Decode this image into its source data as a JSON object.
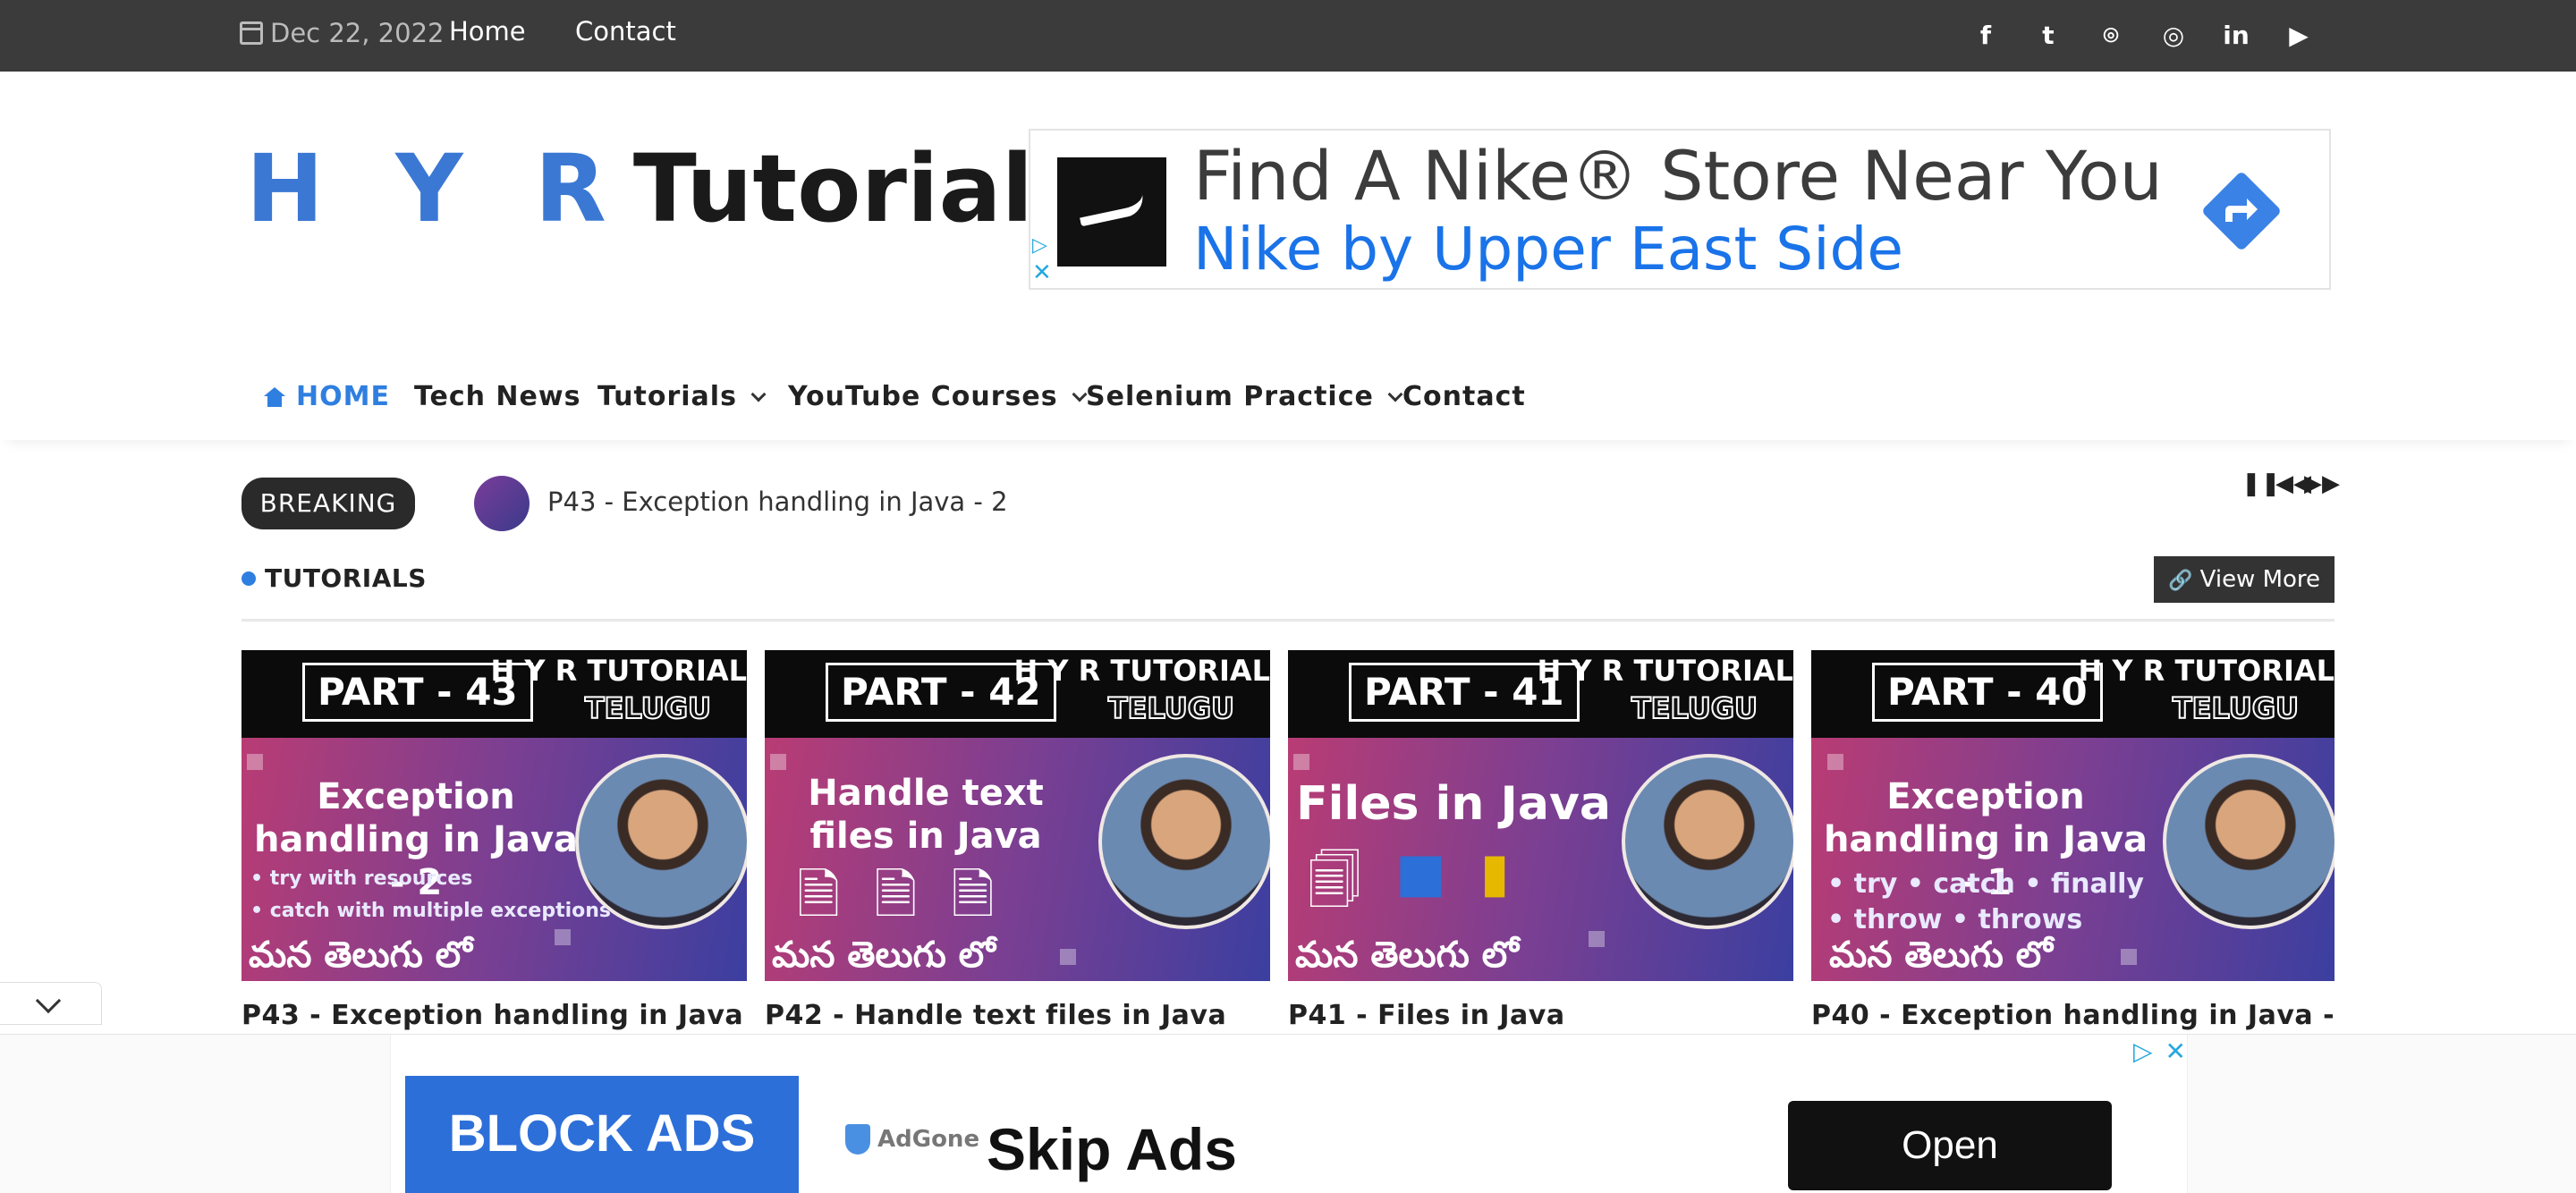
{
  "topbar": {
    "date": "Dec 22, 2022",
    "links": [
      "Home",
      "Contact"
    ],
    "social_icons": [
      "facebook-icon",
      "twitter-icon",
      "github-icon",
      "instagram-icon",
      "linkedin-icon",
      "youtube-icon"
    ],
    "social_glyphs": [
      "f",
      "t",
      "⌾",
      "◎",
      "in",
      "▶"
    ]
  },
  "logo": {
    "hyr": "H Y R",
    "tutorials": "Tutorials"
  },
  "top_ad": {
    "title": "Find A Nike® Store Near You",
    "subtitle": "Nike by Upper East Side",
    "info_icon": "▷",
    "close_icon": "✕"
  },
  "nav": {
    "items": [
      {
        "label": "HOME",
        "active": true
      },
      {
        "label": "Tech News"
      },
      {
        "label": "Tutorials",
        "dropdown": true
      },
      {
        "label": "YouTube Courses",
        "dropdown": true
      },
      {
        "label": "Selenium Practice",
        "dropdown": true
      },
      {
        "label": "Contact"
      }
    ]
  },
  "breaking": {
    "badge": "BREAKING",
    "text": "P43 - Exception handling in Java - 2",
    "controls": [
      "❚❚",
      "◀◀",
      "▶▶"
    ]
  },
  "section": {
    "title": "TUTORIALS",
    "view_more": "View More",
    "link_icon": "🔗"
  },
  "cards": [
    {
      "part": "PART - 43",
      "brand": "H Y R TUTORIAL",
      "telugu_tag": "TELUGU",
      "headline": "Exception handling in Java - 2",
      "bullets": [
        "• try with resources",
        "• catch with multiple exceptions"
      ],
      "footer": "మన తెలుగు లో",
      "title": "P43 - Exception handling in Java"
    },
    {
      "part": "PART - 42",
      "brand": "H Y R TUTORIAL",
      "telugu_tag": "TELUGU",
      "headline": "Handle text files in Java",
      "bullets": [],
      "footer": "మన తెలుగు లో",
      "title": "P42 - Handle text files in Java"
    },
    {
      "part": "PART - 41",
      "brand": "H Y R TUTORIAL",
      "telugu_tag": "TELUGU",
      "headline": "Files in Java",
      "bullets": [],
      "footer": "మన తెలుగు లో",
      "title": "P41 - Files in Java"
    },
    {
      "part": "PART - 40",
      "brand": "H Y R TUTORIAL",
      "telugu_tag": "TELUGU",
      "headline": "Exception handling in Java - 1",
      "bullets": [
        "• try   • catch   • finally",
        "• throw  • throws"
      ],
      "footer": "మన తెలుగు లో",
      "title": "P40 - Exception handling in Java -"
    }
  ],
  "bottom_ad": {
    "block_label": "BLOCK ADS",
    "adgone_label": "AdGone",
    "skip_label": "Skip Ads",
    "open_label": "Open",
    "info_icon": "▷",
    "close_icon": "✕"
  },
  "colors": {
    "accent": "#2f7fe0",
    "topbar": "#3b3b3b",
    "nike_blue": "#1a73e8"
  }
}
